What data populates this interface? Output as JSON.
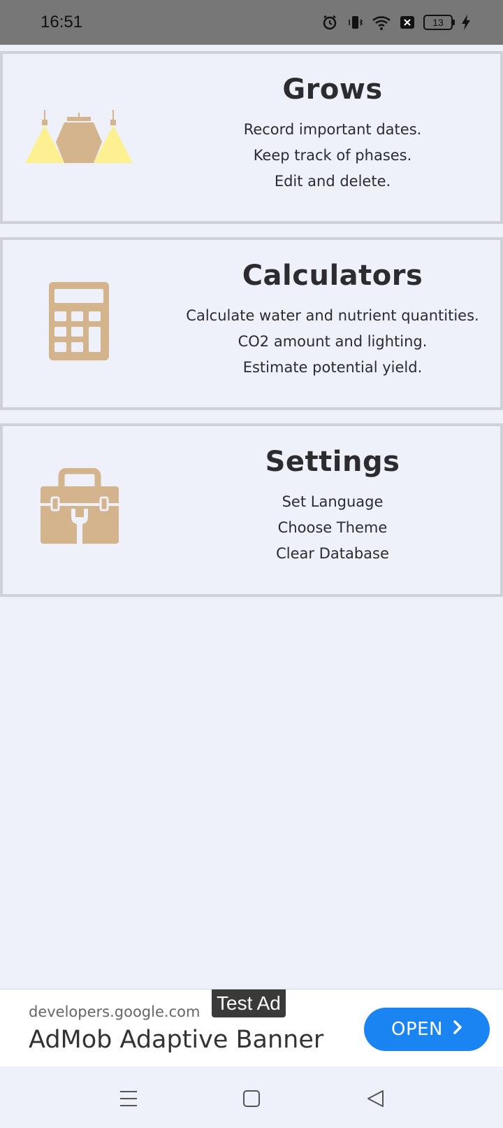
{
  "status_bar": {
    "time": "16:51",
    "battery_level": "13",
    "icons": [
      "alarm-icon",
      "vibrate-icon",
      "wifi-icon",
      "sim-off-icon",
      "battery-icon",
      "charging-icon"
    ]
  },
  "cards": [
    {
      "id": "grows",
      "title": "Grows",
      "icon": "grow-lamps-icon",
      "lines": [
        "Record important dates.",
        "Keep track of phases.",
        "Edit and delete."
      ]
    },
    {
      "id": "calculators",
      "title": "Calculators",
      "icon": "calculator-icon",
      "lines": [
        "Calculate water and nutrient quantities.",
        "CO2 amount and lighting.",
        "Estimate potential yield."
      ]
    },
    {
      "id": "settings",
      "title": "Settings",
      "icon": "toolbox-icon",
      "lines": [
        "Set Language",
        "Choose Theme",
        "Clear Database"
      ]
    }
  ],
  "ad": {
    "badge": "Test Ad",
    "domain": "developers.google.com",
    "headline": "AdMob Adaptive Banner",
    "button_label": "OPEN"
  },
  "nav": {
    "icons": [
      "menu-icon",
      "home-square-icon",
      "back-triangle-icon"
    ]
  },
  "colors": {
    "background": "#eef0fa",
    "icon_tan": "#d4b48c",
    "lamp_yellow": "#fdf091",
    "ad_button": "#1a84f3",
    "status_bar": "#777777"
  }
}
